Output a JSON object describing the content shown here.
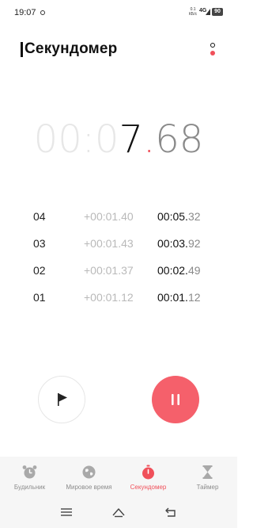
{
  "status_bar": {
    "time": "19:07",
    "speed_top": "0.1",
    "speed_bottom": "КБ/с",
    "network": "4G",
    "battery": "90"
  },
  "header": {
    "title": "Секундомер"
  },
  "timer": {
    "faded": "00:0",
    "seconds": "7",
    "dot": ".",
    "fraction": "68"
  },
  "laps": [
    {
      "num": "04",
      "split": "+00:01.40",
      "total_main": "00:05.",
      "total_frac": "32"
    },
    {
      "num": "03",
      "split": "+00:01.43",
      "total_main": "00:03.",
      "total_frac": "92"
    },
    {
      "num": "02",
      "split": "+00:01.37",
      "total_main": "00:02.",
      "total_frac": "49"
    },
    {
      "num": "01",
      "split": "+00:01.12",
      "total_main": "00:01.",
      "total_frac": "12"
    }
  ],
  "controls": {
    "lap_icon": "flag-icon",
    "pause_icon": "pause-icon"
  },
  "bottom_nav": {
    "items": [
      {
        "label": "Будильник",
        "icon": "alarm-icon"
      },
      {
        "label": "Мировое время",
        "icon": "globe-icon"
      },
      {
        "label": "Секундомер",
        "icon": "stopwatch-icon",
        "active": true
      },
      {
        "label": "Таймер",
        "icon": "hourglass-icon"
      }
    ]
  },
  "colors": {
    "accent": "#f0505a",
    "pause_button": "#f5606b"
  }
}
